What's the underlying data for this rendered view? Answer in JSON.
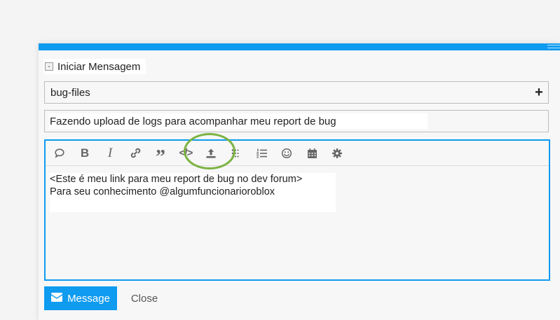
{
  "header": {
    "label": "Iniciar Mensagem"
  },
  "category": {
    "value": "bug-files",
    "add_icon": "plus-icon"
  },
  "title_field": {
    "value": "Fazendo upload de logs para acompanhar meu report de bug"
  },
  "toolbar": {
    "items": [
      {
        "name": "quote-bubble-icon"
      },
      {
        "name": "bold-icon",
        "glyph": "B"
      },
      {
        "name": "italic-icon",
        "glyph": "I"
      },
      {
        "name": "link-icon"
      },
      {
        "name": "blockquote-icon",
        "glyph": "”"
      },
      {
        "name": "code-icon",
        "glyph": "</>"
      },
      {
        "name": "upload-icon"
      },
      {
        "name": "bullet-list-icon"
      },
      {
        "name": "numbered-list-icon"
      },
      {
        "name": "emoji-icon"
      },
      {
        "name": "calendar-icon"
      },
      {
        "name": "gear-icon"
      }
    ]
  },
  "editor": {
    "lines": [
      "<Este é meu link para meu report de bug no dev forum>",
      "Para seu conhecimento @algumfuncionarioroblox"
    ]
  },
  "actions": {
    "send_label": "Message",
    "close_label": "Close"
  },
  "colors": {
    "accent": "#0e9bf0",
    "highlight_circle": "#7cb342"
  }
}
